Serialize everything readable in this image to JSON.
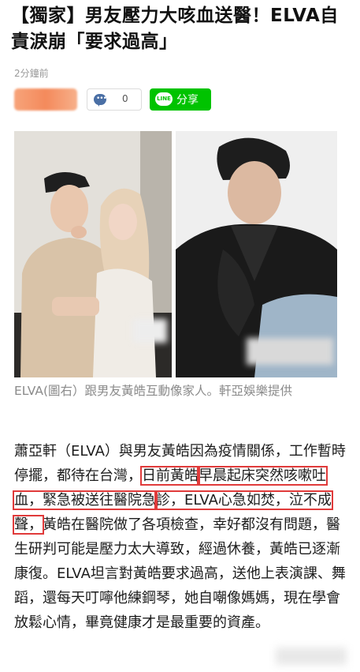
{
  "article": {
    "title": "【獨家】男友壓力大咳血送醫！ELVA自責淚崩「要求過高」",
    "timestamp": "2分鐘前",
    "comment_count": "0",
    "share_icon_text": "LINE",
    "share_label": "分享",
    "image_caption": "ELVA(圖右）跟男友黃皓互動像家人。軒亞娛樂提供",
    "body": {
      "seg1": "蕭亞軒（ELVA）與男友黃皓因為疫情關係，工作暫時停擺，都待在台灣，",
      "seg2": "日前黃皓",
      "seg3": "早晨起床突然咳嗽吐血，緊急被送往醫院急",
      "seg4": "診，ELVA心急如焚，泣不成聲，",
      "seg5": "黃皓在醫院做了各項檢查，幸好都沒有問題，醫生研判可能是壓力太大導致，經過休養，黃皓已逐漸康復。ELVA坦言對黃皓要求過高，送他上表演課、舞蹈，還每天叮嚀他練鋼琴，她自嘲像媽媽，現在學會放鬆心情，畢竟健康才是最重要的資產。"
    }
  },
  "colors": {
    "highlight": "#e03a3a",
    "line_green": "#00c300",
    "comment_icon": "#4a6fa5",
    "caption": "#8a8a8a"
  },
  "icons": {
    "comment": "speech-bubble-icon",
    "share": "line-logo-icon"
  }
}
